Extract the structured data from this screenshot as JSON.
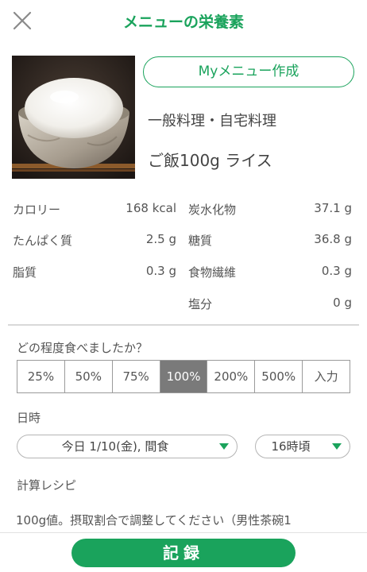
{
  "header": {
    "title": "メニューの栄養素"
  },
  "food": {
    "my_menu_button": "Myメニュー作成",
    "category": "一般料理・自宅料理",
    "name": "ご飯100g ライス"
  },
  "nutrients": {
    "left": [
      {
        "label": "カロリー",
        "value": "168 kcal"
      },
      {
        "label": "たんぱく質",
        "value": "2.5 g"
      },
      {
        "label": "脂質",
        "value": "0.3 g"
      }
    ],
    "right": [
      {
        "label": "炭水化物",
        "value": "37.1 g"
      },
      {
        "label": "糖質",
        "value": "36.8 g"
      },
      {
        "label": "食物繊維",
        "value": "0.3 g"
      },
      {
        "label": "塩分",
        "value": "0 g"
      }
    ]
  },
  "amount": {
    "question": "どの程度食べましたか？",
    "options": [
      "25%",
      "50%",
      "75%",
      "100%",
      "200%",
      "500%",
      "入力"
    ],
    "selected": "100%"
  },
  "datetime": {
    "label": "日時",
    "date_value": "今日 1/10(金), 間食",
    "time_value": "16時頃"
  },
  "recipe": {
    "label": "計算レシピ",
    "text": "100g値。摂取割合で調整してください（男性茶碗1"
  },
  "footer": {
    "record_button": "記録"
  },
  "colors": {
    "accent": "#1aa35c",
    "selected_segment": "#7a7a7a"
  }
}
